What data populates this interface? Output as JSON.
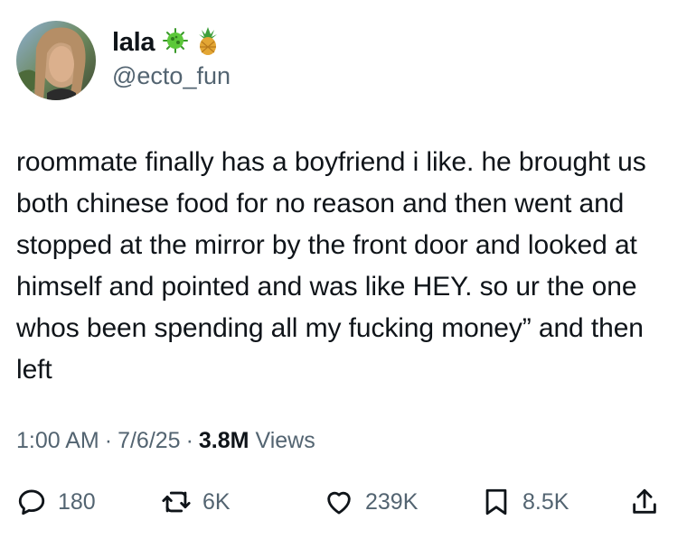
{
  "user": {
    "display_name": "lala",
    "handle": "@ecto_fun",
    "badges": [
      "microbe-emoji",
      "pineapple-emoji"
    ]
  },
  "tweet": {
    "text": "roommate finally has a boyfriend i like. he brought us both chinese food for no reason and then went and stopped at the mirror by the front door and looked at himself and pointed and was like HEY. so ur the one whos been spending all my fucking money” and then left",
    "time": "1:00 AM",
    "separator": "·",
    "date": "7/6/25",
    "views_count": "3.8M",
    "views_label": "Views"
  },
  "actions": {
    "replies": "180",
    "retweets": "6K",
    "likes": "239K",
    "bookmarks": "8.5K"
  },
  "colors": {
    "text": "#0f1419",
    "secondary": "#536471"
  }
}
